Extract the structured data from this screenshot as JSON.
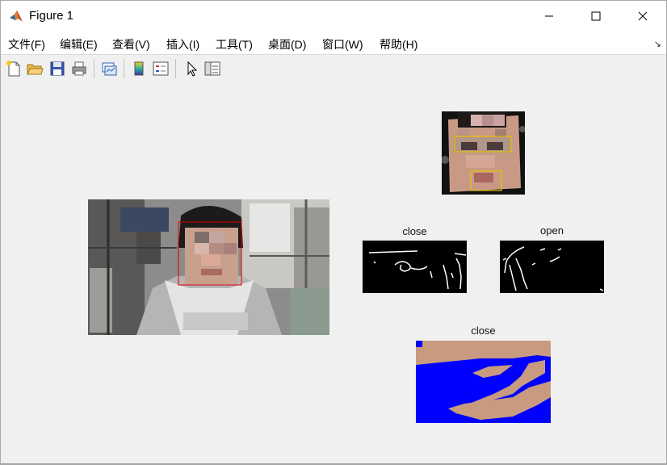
{
  "window": {
    "title": "Figure 1"
  },
  "menu": {
    "items": [
      {
        "label": "文件(F)"
      },
      {
        "label": "编辑(E)"
      },
      {
        "label": "查看(V)"
      },
      {
        "label": "插入(I)"
      },
      {
        "label": "工具(T)"
      },
      {
        "label": "桌面(D)"
      },
      {
        "label": "窗口(W)"
      },
      {
        "label": "帮助(H)"
      }
    ],
    "dock_arrow": "↘"
  },
  "toolbar": {
    "icons": [
      "new-figure-icon",
      "open-file-icon",
      "save-icon",
      "print-icon",
      "link-plot-icon",
      "colorbar-icon",
      "legend-icon",
      "pointer-icon",
      "property-editor-icon"
    ]
  },
  "axes": {
    "face_detect": {
      "title": ""
    },
    "face_crop": {
      "title": ""
    },
    "eye_close": {
      "title": "close"
    },
    "eye_open": {
      "title": "open"
    },
    "mouth_close": {
      "title": "close"
    }
  },
  "colors": {
    "face_box": "#e00000",
    "feature_box": "#e8c000",
    "mask_blue": "#0000ff",
    "skin": "#c89a80"
  }
}
